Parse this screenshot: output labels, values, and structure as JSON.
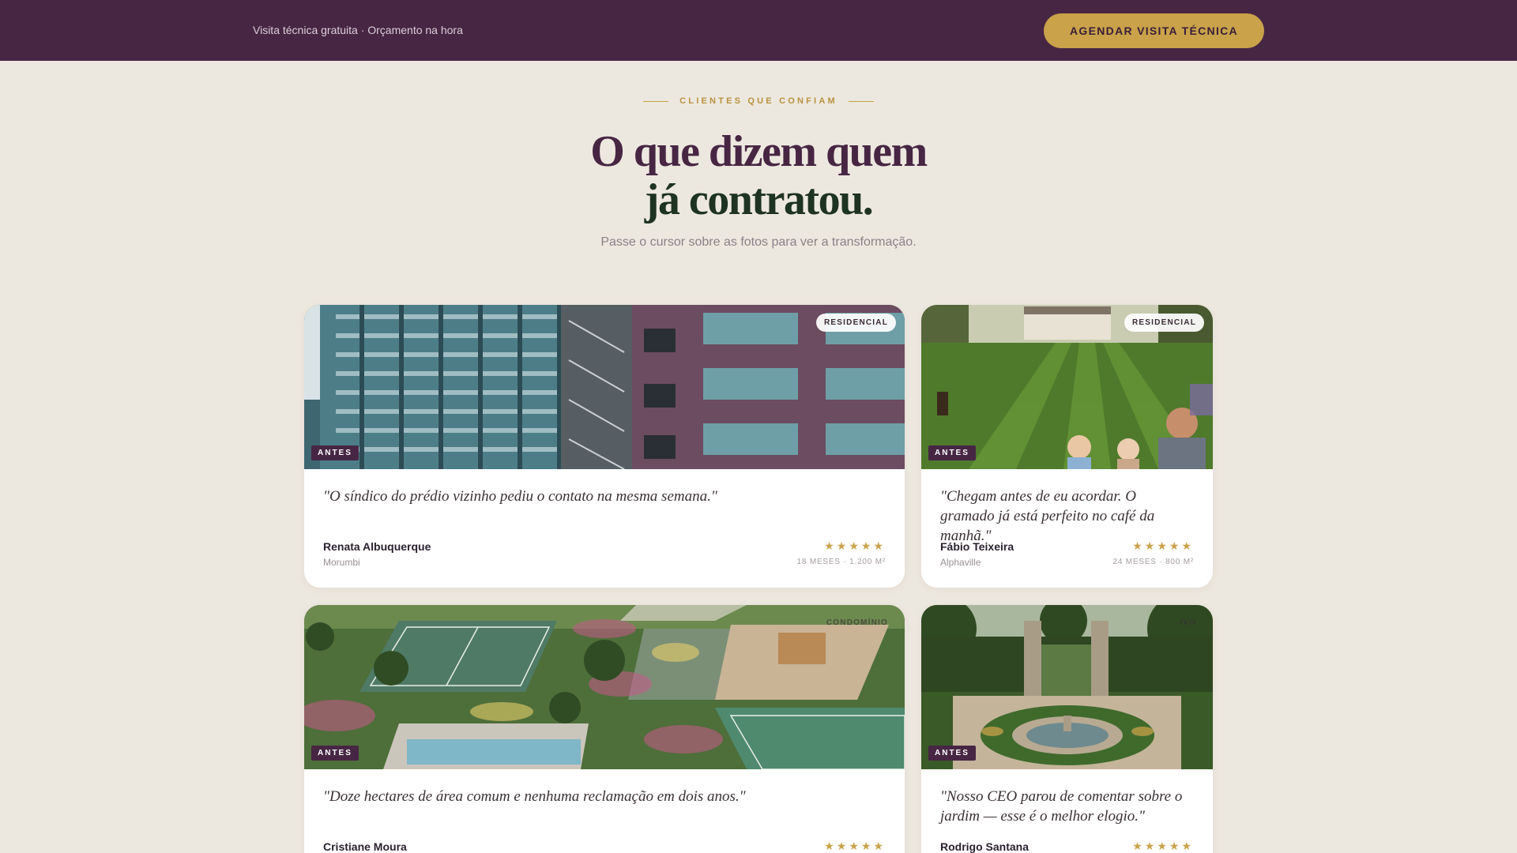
{
  "topbar": {
    "text": "Visita técnica gratuita · Orçamento na hora",
    "cta_label": "AGENDAR VISITA TÉCNICA",
    "background_color": "#472644",
    "cta_color": "#C9A24A"
  },
  "section": {
    "eyebrow": "CLIENTES QUE CONFIAM",
    "heading_line1": "O que dizem quem",
    "heading_line2": "já contratou.",
    "subtitle": "Passe o cursor sobre as fotos para ver a transformação."
  },
  "testimonials": [
    {
      "category": "RESIDENCIAL",
      "state_badge": "ANTES",
      "photo": "city-buildings-photo",
      "quote": "\"O síndico do prédio vizinho pediu o contato na mesma semana.\"",
      "name": "Renata Albuquerque",
      "location": "Morumbi",
      "rating": 5,
      "stars": "★★★★★",
      "meta": "18 MESES · 1.200 M²"
    },
    {
      "category": "RESIDENCIAL",
      "state_badge": "ANTES",
      "photo": "lawn-family-photo",
      "quote": "\"Chegam antes de eu acordar. O gramado já está perfeito no café da manhã.\"",
      "name": "Fábio Teixeira",
      "location": "Alphaville",
      "rating": 5,
      "stars": "★★★★★",
      "meta": "24 MESES · 800 M²"
    },
    {
      "category": "CONDOMÍNIO",
      "state_badge": "ANTES",
      "photo": "condominium-garden-photo",
      "quote": "\"Doze hectares de área comum e nenhuma reclamação em dois anos.\"",
      "name": "Cristiane Moura",
      "rating": 5,
      "stars": "★★★★★"
    },
    {
      "category": "…IVO",
      "state_badge": "ANTES",
      "photo": "formal-garden-fountain-photo",
      "quote": "\"Nosso CEO parou de comentar sobre o jardim — esse é o melhor elogio.\"",
      "name": "Rodrigo Santana",
      "rating": 5,
      "stars": "★★★★★"
    }
  ]
}
